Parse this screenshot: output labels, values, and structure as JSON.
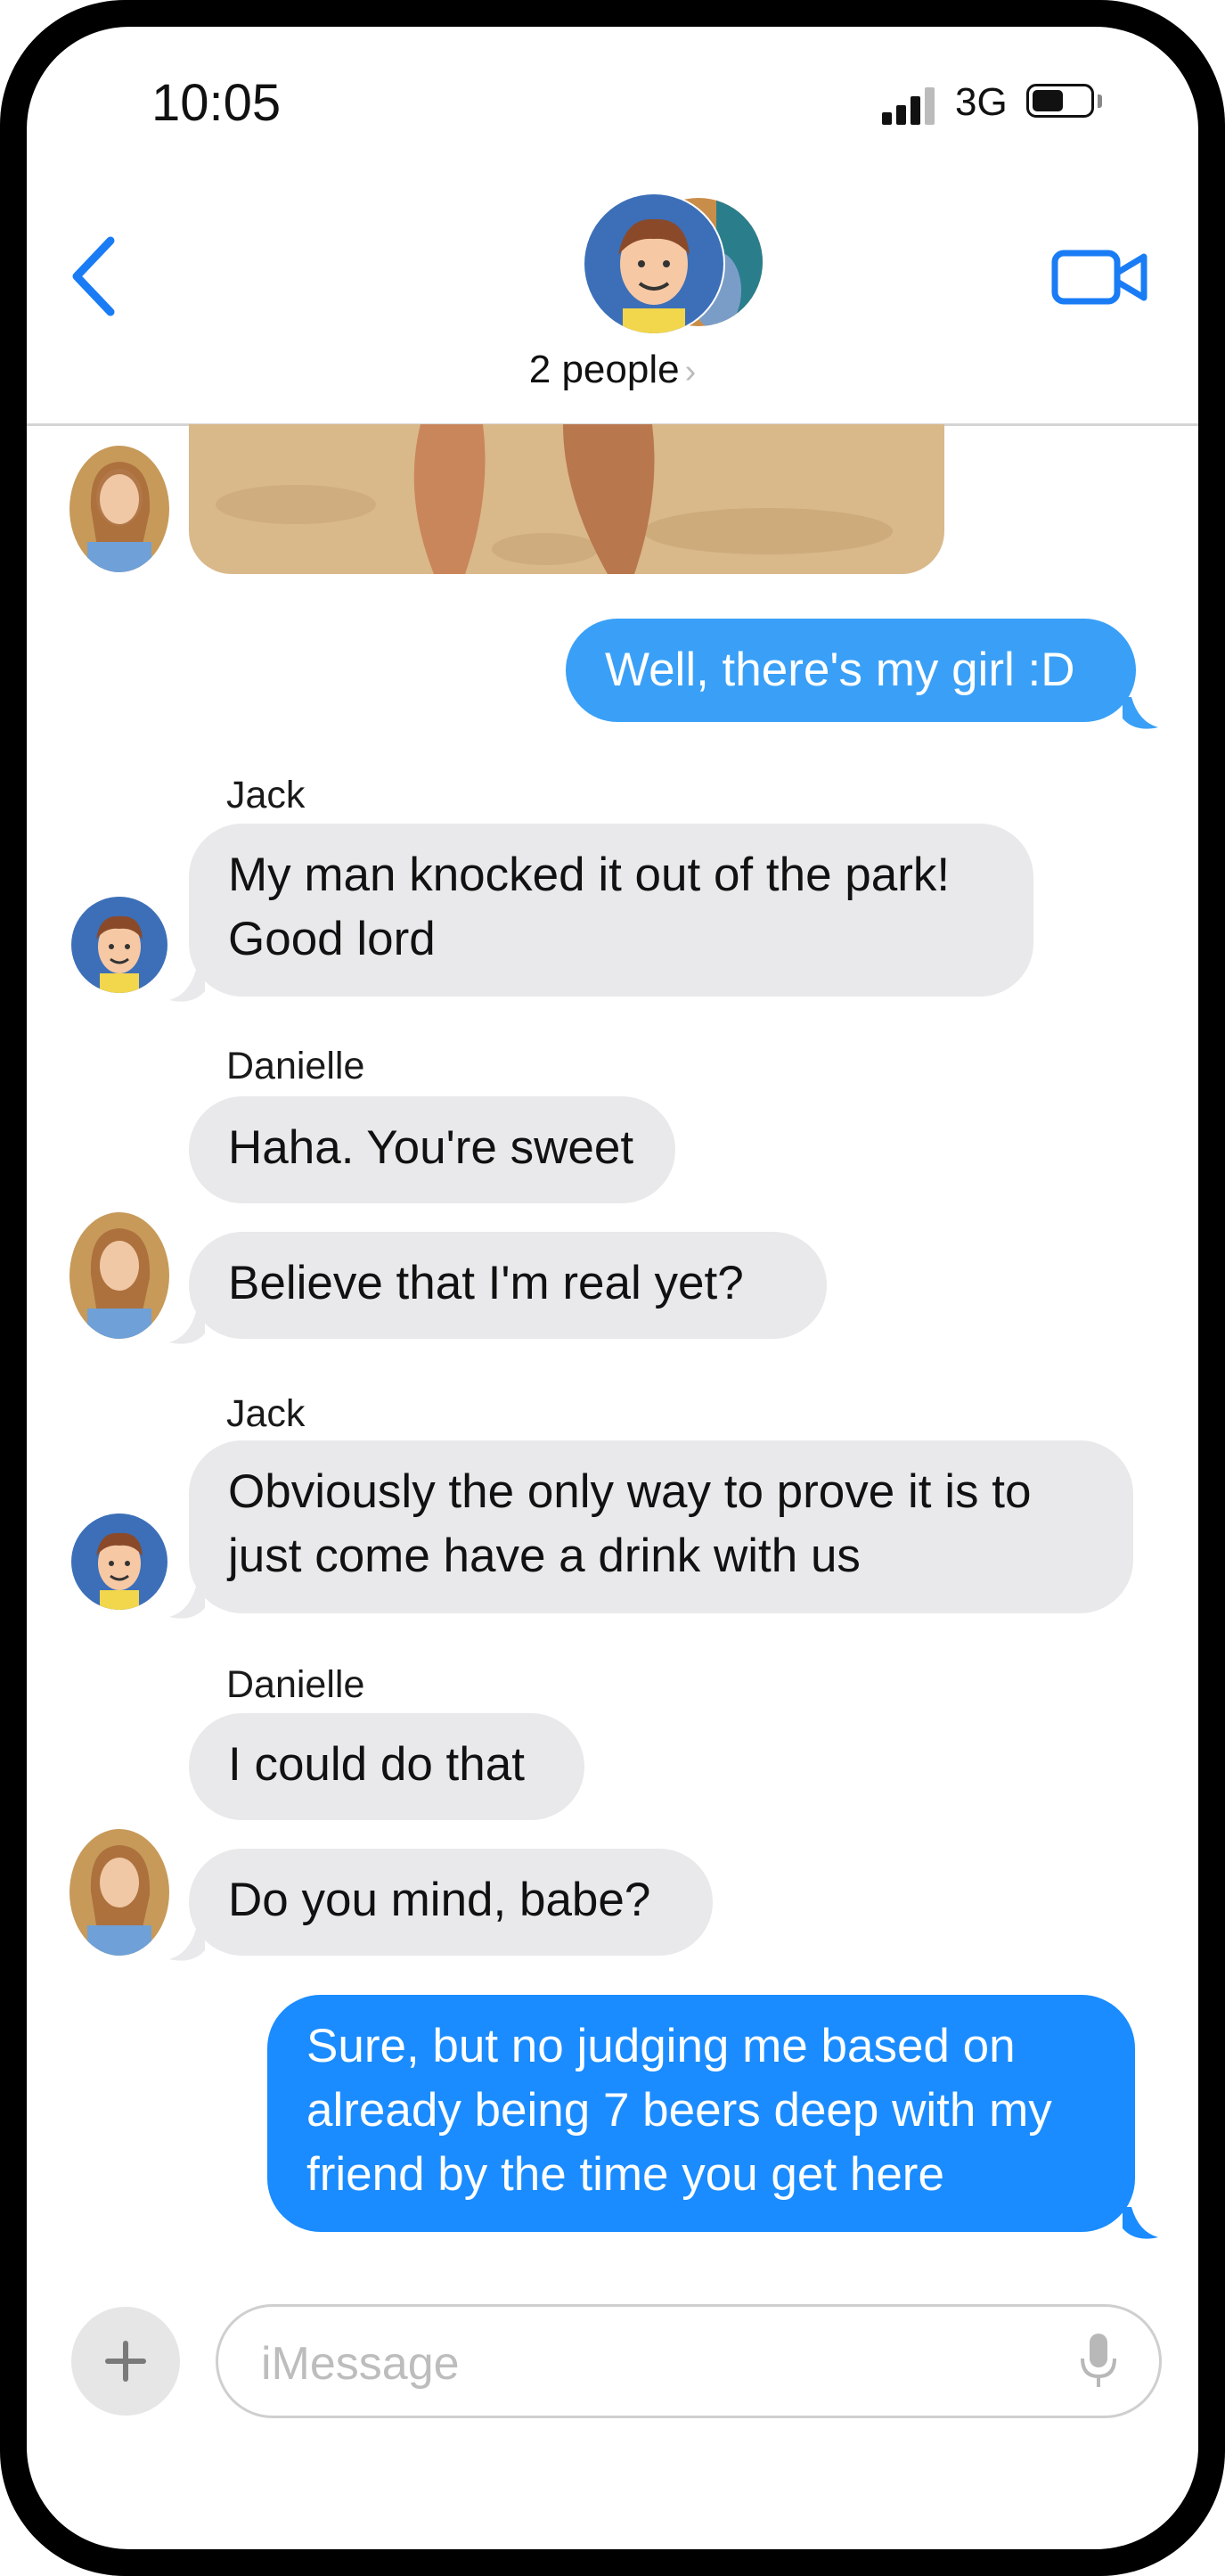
{
  "status_bar": {
    "time": "10:05",
    "network": "3G",
    "icons": [
      "signal-icon",
      "battery-icon"
    ]
  },
  "header": {
    "title": "2 people",
    "chevron": "›",
    "icons": [
      "back-chevron-icon",
      "video-camera-icon"
    ]
  },
  "messages": [
    {
      "type": "photo",
      "sender": "Danielle",
      "description_icon": "beach-photo"
    },
    {
      "type": "outgoing",
      "lines": [
        "Well, there's my girl :D"
      ]
    },
    {
      "type": "incoming",
      "sender": "Jack",
      "lines": [
        "My man knocked it out of the park!",
        "Good lord"
      ]
    },
    {
      "type": "incoming",
      "sender": "Danielle",
      "lines": [
        "Haha.  You're sweet"
      ]
    },
    {
      "type": "incoming",
      "lines": [
        "Believe that I'm real yet?"
      ]
    },
    {
      "type": "incoming",
      "sender": "Jack",
      "lines": [
        "Obviously the only way to prove it is to",
        "just come have a drink with us"
      ]
    },
    {
      "type": "incoming",
      "sender": "Danielle",
      "lines": [
        "I could do that"
      ]
    },
    {
      "type": "incoming",
      "lines": [
        "Do you mind, babe?"
      ]
    },
    {
      "type": "outgoing",
      "lines": [
        "Sure, but no judging me based on",
        "already being 7 beers deep with my",
        "friend by the time you get here"
      ]
    }
  ],
  "input_bar": {
    "placeholder": "iMessage",
    "icons": [
      "plus-icon",
      "microphone-icon"
    ]
  },
  "colors": {
    "outgoing": "#1a8cff",
    "incoming": "#e9e9eb",
    "accent": "#1a7cf5"
  }
}
